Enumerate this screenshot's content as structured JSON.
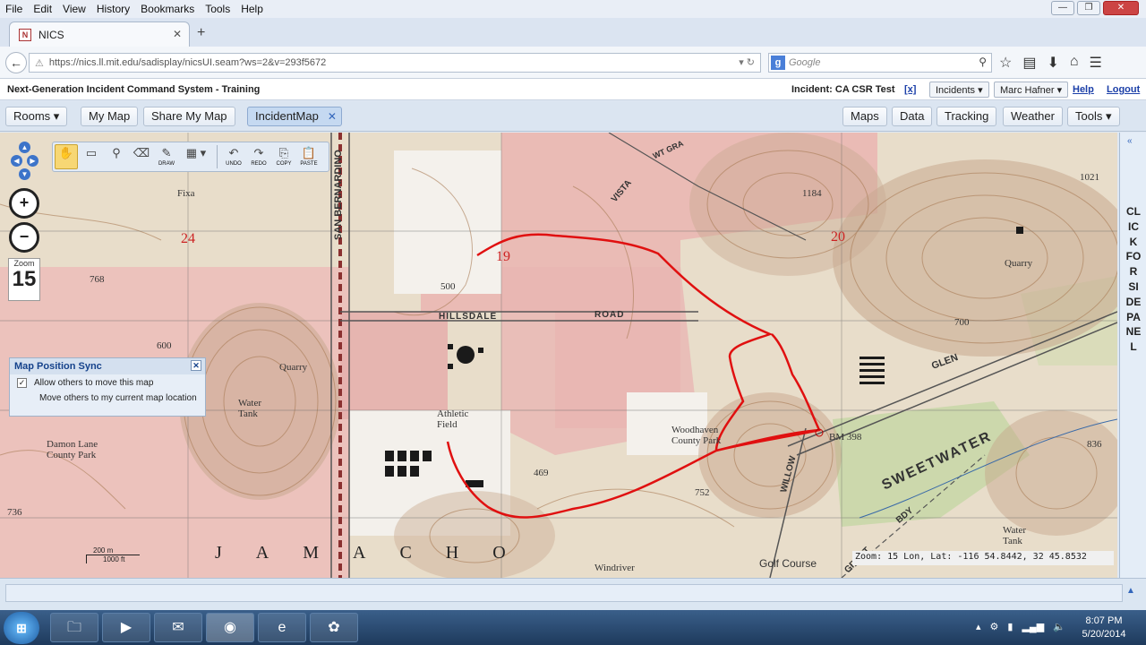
{
  "browser": {
    "menu": [
      "File",
      "Edit",
      "View",
      "History",
      "Bookmarks",
      "Tools",
      "Help"
    ],
    "tab_title": "NICS",
    "url": "https://nics.ll.mit.edu/sadisplay/nicsUI.seam?ws=2&v=293f5672",
    "search_placeholder": "Google"
  },
  "app": {
    "title": "Next-Generation Incident Command System - Training",
    "incident": "Incident: CA CSR Test",
    "incident_close": "[x]",
    "incidents_dd": "Incidents ▾",
    "user_dd": "Marc Hafner ▾",
    "help": "Help",
    "logout": "Logout"
  },
  "toolbar": {
    "rooms": "Rooms ▾",
    "my_map": "My Map",
    "share_map": "Share My Map",
    "incident_map": "IncidentMap",
    "maps": "Maps",
    "data": "Data",
    "tracking": "Tracking",
    "weather": "Weather",
    "tools": "Tools ▾"
  },
  "draw_tools": {
    "draw": "DRAW",
    "undo": "UNDO",
    "redo": "REDO",
    "copy": "COPY",
    "paste": "PASTE"
  },
  "map": {
    "zoom_label": "Zoom",
    "zoom_value": "15",
    "zoom_info": "Zoom: 15  Lon, Lat: -116 54.8442, 32 45.8532",
    "scale_top": "200 m",
    "scale_bottom": "1000 ft",
    "labels": {
      "fixa": "Fixa",
      "sec24": "24",
      "sec19": "19",
      "sec20": "20",
      "c768": "768",
      "c600": "600",
      "c500": "500",
      "c469": "469",
      "c752": "752",
      "c700": "700",
      "c1184": "1184",
      "c1021": "1021",
      "c736": "736",
      "c836": "836",
      "san_bernardino": "SAN BERNARDINO",
      "hillsdale": "HILLSDALE",
      "road": "ROAD",
      "vista": "VISTA",
      "wt_gra": "WT GRA",
      "quarry_left": "Quarry",
      "quarry_right": "Quarry",
      "water_tank": "Water\nTank",
      "water_tank_r": "Water\nTank",
      "damon_lane": "Damon Lane\nCounty Park",
      "athletic_field": "Athletic\nField",
      "woodhaven": "Woodhaven\nCounty Park",
      "bm398": "BM 398",
      "glen": "GLEN",
      "sweetwater": "SWEETWATER",
      "willow": "WILLOW",
      "grant": "GRANT",
      "bdy": "BDY",
      "golf_course": "Golf  Course",
      "windriver": "Windriver",
      "jamacho": "JAMACHO"
    }
  },
  "sync_panel": {
    "title": "Map Position Sync",
    "allow": "Allow others to move this map",
    "move": "Move others to my current map location"
  },
  "side_panel": {
    "text": "CLICK FOR SIDE PANEL"
  },
  "taskbar": {
    "time": "8:07 PM",
    "date": "5/20/2014"
  }
}
